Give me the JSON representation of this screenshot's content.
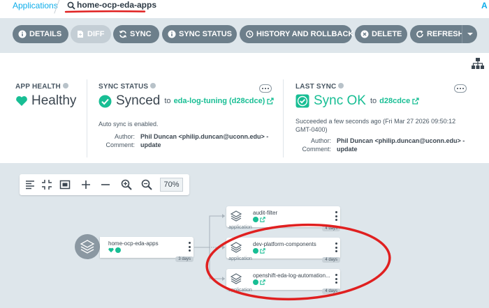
{
  "breadcrumb": {
    "root": "Applications",
    "current": "home-ocp-eda-apps",
    "right_fragment": "A"
  },
  "toolbar": {
    "details": "DETAILS",
    "diff": "DIFF",
    "sync": "SYNC",
    "sync_status": "SYNC STATUS",
    "history": "HISTORY AND ROLLBACK",
    "delete": "DELETE",
    "refresh": "REFRESH"
  },
  "health": {
    "label": "APP HEALTH",
    "value": "Healthy"
  },
  "sync_status": {
    "label": "SYNC STATUS",
    "value": "Synced",
    "to": "to",
    "revision": "eda-log-tuning (d28cdce)",
    "auto": "Auto sync is enabled.",
    "author_key": "Author:",
    "author_val": "Phil Duncan <philip.duncan@uconn.edu> -",
    "comment_key": "Comment:",
    "comment_val": "update"
  },
  "last_sync": {
    "label": "LAST SYNC",
    "value": "Sync OK",
    "to": "to",
    "revision": "d28cdce",
    "line1": "Succeeded a few seconds ago (Fri Mar 27 2026 09:50:12",
    "line2": "GMT-0400)",
    "author_key": "Author:",
    "author_val": "Phil Duncan <philip.duncan@uconn.edu> -",
    "comment_key": "Comment:",
    "comment_val": "update"
  },
  "graph": {
    "zoom": "70%",
    "root_node": {
      "name": "home-ocp-eda-apps",
      "age": "3 days"
    },
    "children": [
      {
        "name": "audit-filter",
        "type": "application",
        "age": "4 days"
      },
      {
        "name": "dev-platform-components",
        "type": "application",
        "age": "4 days"
      },
      {
        "name": "openshift-eda-log-automation...",
        "type": "application",
        "age": "4 days"
      }
    ]
  },
  "colors": {
    "accent": "#0dadea",
    "healthy": "#18be94",
    "toolbar_button": "#6d7f8b",
    "annotation_red": "#e02020"
  },
  "icons": [
    "search-icon",
    "info-icon",
    "file-icon",
    "sync-icon",
    "cancel-icon",
    "refresh-icon",
    "tree-view-icon",
    "heart-icon",
    "check-icon",
    "external-link-icon",
    "layers-icon"
  ]
}
